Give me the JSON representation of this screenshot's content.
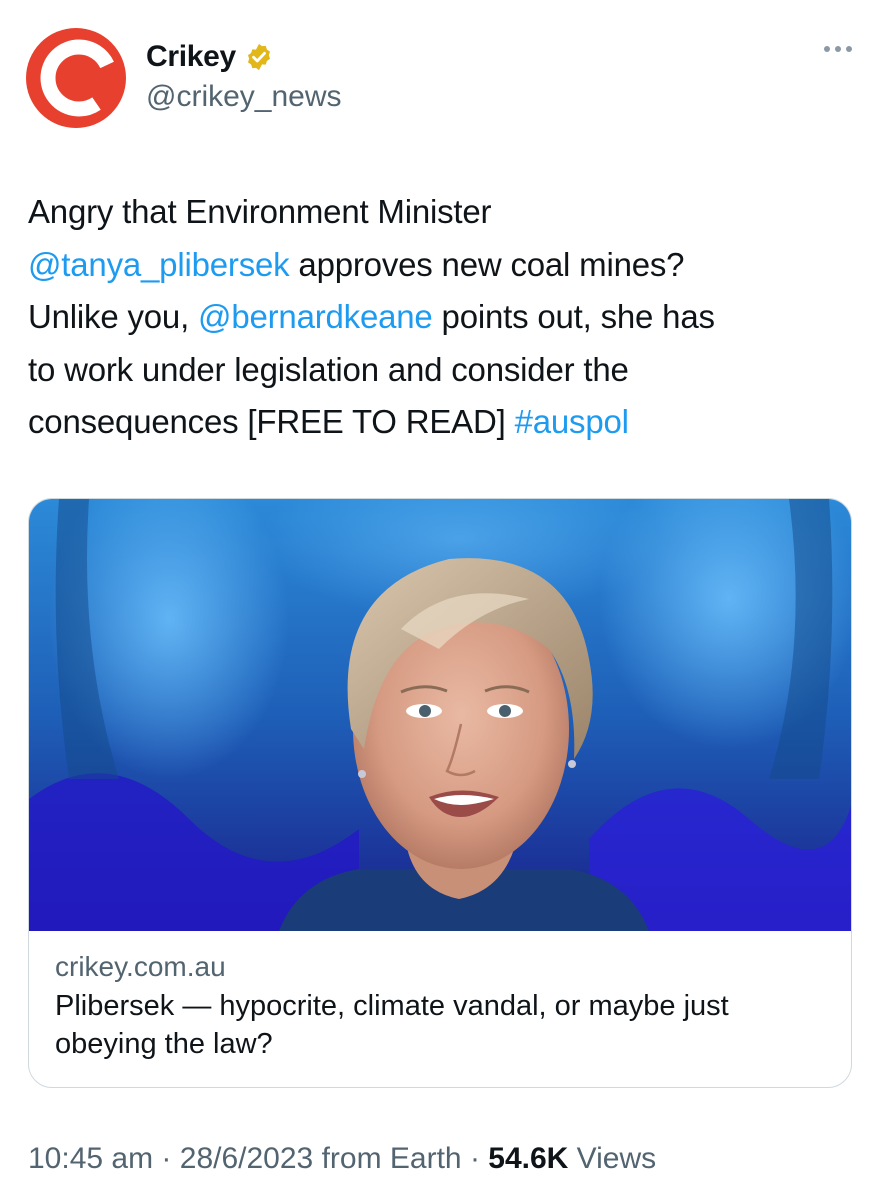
{
  "author": {
    "display_name": "Crikey",
    "handle": "@crikey_news",
    "avatar_icon": "crikey-logo",
    "avatar_color": "#e8402e",
    "verified": true,
    "verified_color": "#e2b719"
  },
  "tweet": {
    "text": {
      "line1": "Angry that Environment Minister",
      "mention1": "@tanya_plibersek",
      "after_mention1": " approves new coal mines?",
      "line3_start": "Unlike you, ",
      "mention2": "@bernardkeane",
      "after_mention2": " points out, she has",
      "line4": "to work under legislation and consider the",
      "line5": "consequences [FREE TO READ] ",
      "hashtag": "#auspol"
    },
    "link_color": "#1d9bf0"
  },
  "card": {
    "image_icon": "article-photo",
    "domain": "crikey.com.au",
    "title": "Plibersek — hypocrite, climate vandal, or maybe just obeying the law?"
  },
  "footer": {
    "time": "10:45 am",
    "separator": " · ",
    "date": "28/6/2023",
    "location": " from Earth",
    "views_count": "54.6K",
    "views_label": " Views"
  }
}
